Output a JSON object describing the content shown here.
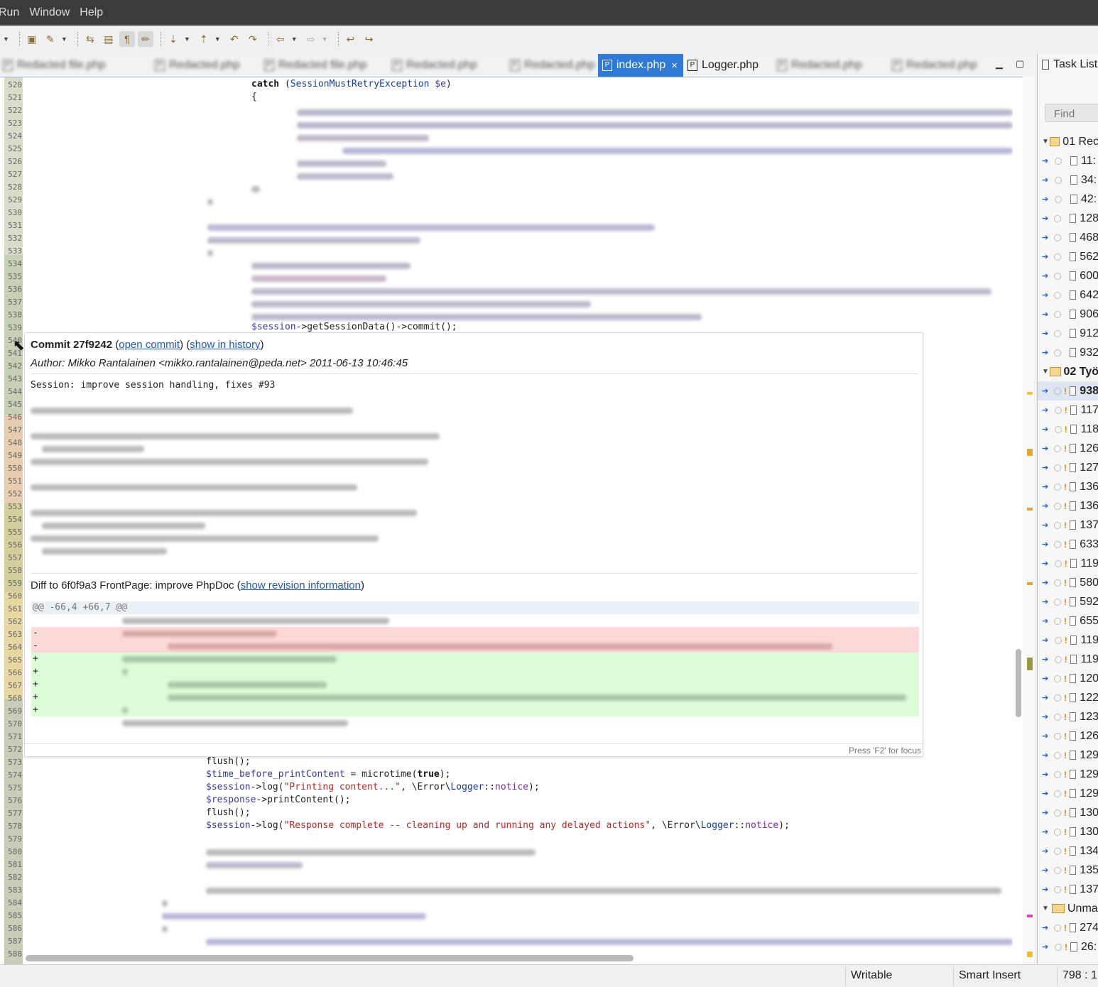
{
  "menubar": {
    "items": [
      "Run",
      "Window",
      "Help"
    ]
  },
  "tabs": {
    "items": [
      {
        "label": "Redacted file.php"
      },
      {
        "label": "Redacted.php"
      },
      {
        "label": "Redacted file.php"
      },
      {
        "label": "Redacted.php"
      },
      {
        "label": "Redacted.php"
      }
    ],
    "active": "index.php",
    "active_close": "×",
    "second": "Logger.php",
    "trailing": [
      {
        "label": "Redacted.php"
      },
      {
        "label": "Redacted.php"
      }
    ]
  },
  "window_controls": {
    "minimize": "▁",
    "maximize": "▢"
  },
  "editor": {
    "line_numbers": [
      "520",
      "521",
      "522",
      "523",
      "524",
      "525",
      "526",
      "527",
      "528",
      "529",
      "530",
      "531",
      "532",
      "533",
      "534",
      "535",
      "536",
      "537",
      "538",
      "539",
      "540",
      "541",
      "542",
      "543",
      "544",
      "545",
      "546",
      "547",
      "548",
      "549",
      "550",
      "551",
      "552",
      "553",
      "554",
      "555",
      "556",
      "557",
      "558",
      "559",
      "560",
      "561",
      "562",
      "563",
      "564",
      "565",
      "566",
      "567",
      "568",
      "569",
      "570",
      "571",
      "572",
      "573",
      "574",
      "575",
      "576",
      "577",
      "578",
      "579",
      "580",
      "581",
      "582",
      "583",
      "584",
      "585",
      "586",
      "587",
      "588"
    ],
    "catch_kw": "catch",
    "catch_open": " (",
    "catch_class": "SessionMustRetryException",
    "catch_var": " $e",
    "catch_close": ")",
    "brace": "{",
    "commit_line_var": "$session",
    "commit_line_rest": "->getSessionData()->commit();",
    "after": {
      "flush1": "flush();",
      "tbp_var": "$time_before_printContent",
      "tbp_mid": " = microtime(",
      "tbp_kw": "true",
      "tbp_end": ");",
      "log1_var": "$session",
      "log1_mid": "->log(",
      "log1_str": "\"Printing content...\"",
      "log1_sep": ", \\Error\\",
      "log1_cls": "Logger",
      "log1_colons": "::",
      "log1_const": "notice",
      "log1_end": ");",
      "resp_var": "$response",
      "resp_rest": "->printContent();",
      "flush2": "flush();",
      "log2_var": "$session",
      "log2_mid": "->log(",
      "log2_str": "\"Response complete -- cleaning up and running any delayed actions\"",
      "log2_sep": ", \\Error\\",
      "log2_cls": "Logger",
      "log2_colons": "::",
      "log2_const": "notice",
      "log2_end": ");"
    }
  },
  "popup": {
    "commit_label": "Commit 27f9242",
    "open_paren": " (",
    "open_commit": "open commit",
    "mid_paren": ") (",
    "show_in_history": "show in history",
    "close_paren": ")",
    "author": "Author: Mikko Rantalainen <mikko.rantalainen@peda.net> 2011-06-13 10:46:45",
    "message": "Session: improve session handling, fixes #93",
    "diff_title": "Diff to 6f0f9a3 FrontPage: improve PhpDoc (",
    "show_revision": "show revision information",
    "diff_title_end": ")",
    "hunk": "@@ -66,4 +66,7 @@",
    "minus": "-",
    "plus": "+",
    "focus_hint": "Press 'F2' for focus"
  },
  "task_list": {
    "title": "Task List",
    "find_placeholder": "Find",
    "groups": [
      "01 Rec",
      "02 Työ",
      "Unma"
    ],
    "items": [
      "11:",
      "34:",
      "42:",
      "128",
      "468",
      "562",
      "600",
      "642",
      "906",
      "912",
      "932",
      "938",
      "117",
      "118",
      "126",
      "127",
      "136",
      "136",
      "137",
      "633",
      "119",
      "580",
      "592",
      "655",
      "119",
      "119",
      "120",
      "122",
      "123",
      "126",
      "129",
      "129",
      "129",
      "130",
      "130",
      "134",
      "135",
      "137",
      "274",
      "26:"
    ]
  },
  "status": {
    "writable": "Writable",
    "insert_mode": "Smart Insert",
    "position": "798 : 1"
  },
  "colors": {
    "accent": "#2f7ad6",
    "link": "#1d57c7",
    "diff_del": "#fcd9d9",
    "diff_add": "#dcfcd8"
  }
}
